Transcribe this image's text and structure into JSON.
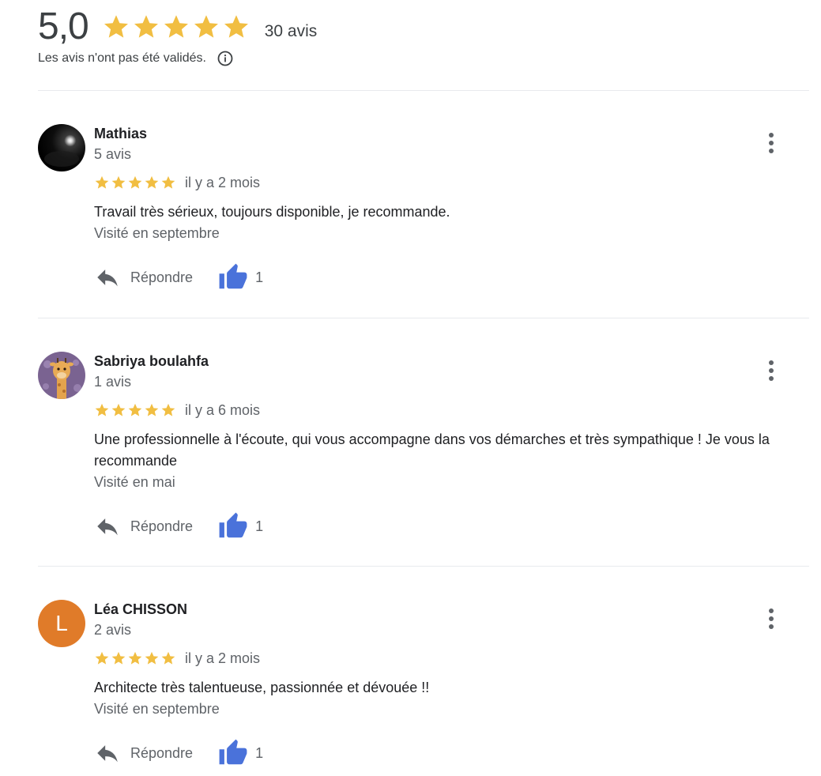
{
  "summary": {
    "rating": "5,0",
    "stars": 5,
    "total": "30 avis",
    "disclaimer": "Les avis n'ont pas été validés.",
    "info_icon": "info-icon",
    "star_color": "#F1BE42"
  },
  "reviews": [
    {
      "name": "Mathias",
      "count": "5 avis",
      "stars": 5,
      "date": "il y a 2 mois",
      "text": "Travail très sérieux, toujours disponible, je recommande.",
      "visited": "Visité en septembre",
      "reply_label": "Répondre",
      "likes": "1",
      "avatar": "photo-dark-sky"
    },
    {
      "name": "Sabriya boulahfa",
      "count": "1 avis",
      "stars": 5,
      "date": "il y a 6 mois",
      "text": "Une professionnelle à l'écoute, qui vous accompagne dans vos démarches et très sympathique ! Je vous la recommande",
      "visited": "Visité en mai",
      "reply_label": "Répondre",
      "likes": "1",
      "avatar": "giraffe-illustration"
    },
    {
      "name": "Léa CHISSON",
      "count": "2 avis",
      "stars": 5,
      "date": "il y a 2 mois",
      "text": "Architecte très talentueuse, passionnée et dévouée !!",
      "visited": "Visité en septembre",
      "reply_label": "Répondre",
      "likes": "1",
      "avatar": "letter-L",
      "avatar_letter": "L",
      "avatar_color": "#E07B29"
    }
  ],
  "colors": {
    "thumb": "#4A72DA",
    "reply_icon": "#5F6368"
  }
}
